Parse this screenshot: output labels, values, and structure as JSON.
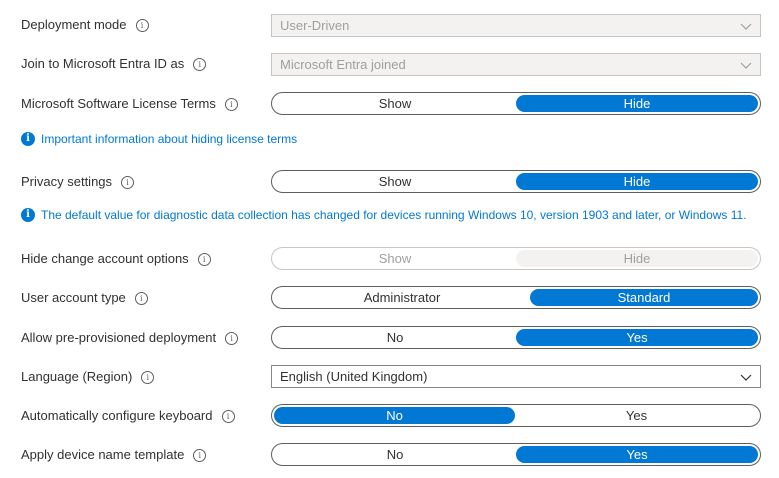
{
  "fields": {
    "deployment_mode": {
      "label": "Deployment mode",
      "value": "User-Driven"
    },
    "join_entra": {
      "label": "Join to Microsoft Entra ID as",
      "value": "Microsoft Entra joined"
    },
    "license_terms": {
      "label": "Microsoft Software License Terms",
      "options": [
        "Show",
        "Hide"
      ],
      "selected": "Hide"
    },
    "license_info": "Important information about hiding license terms",
    "privacy": {
      "label": "Privacy settings",
      "options": [
        "Show",
        "Hide"
      ],
      "selected": "Hide"
    },
    "privacy_info": "The default value for diagnostic data collection has changed for devices running Windows 10, version 1903 and later, or Windows 11.",
    "hide_change_account": {
      "label": "Hide change account options",
      "options": [
        "Show",
        "Hide"
      ],
      "selected": "Hide"
    },
    "user_account_type": {
      "label": "User account type",
      "options": [
        "Administrator",
        "Standard"
      ],
      "selected": "Standard"
    },
    "pre_provisioned": {
      "label": "Allow pre-provisioned deployment",
      "options": [
        "No",
        "Yes"
      ],
      "selected": "Yes"
    },
    "language": {
      "label": "Language (Region)",
      "value": "English (United Kingdom)"
    },
    "auto_keyboard": {
      "label": "Automatically configure keyboard",
      "options": [
        "No",
        "Yes"
      ],
      "selected": "No"
    },
    "device_name_template": {
      "label": "Apply device name template",
      "options": [
        "No",
        "Yes"
      ],
      "selected": "Yes"
    }
  },
  "colors": {
    "accent": "#0078d4",
    "text": "#323130",
    "disabled_text": "#a19f9d"
  },
  "icons": {
    "field_info": "info-circle-outline-icon",
    "message_info": "info-filled-icon",
    "dropdown": "chevron-down-icon"
  }
}
